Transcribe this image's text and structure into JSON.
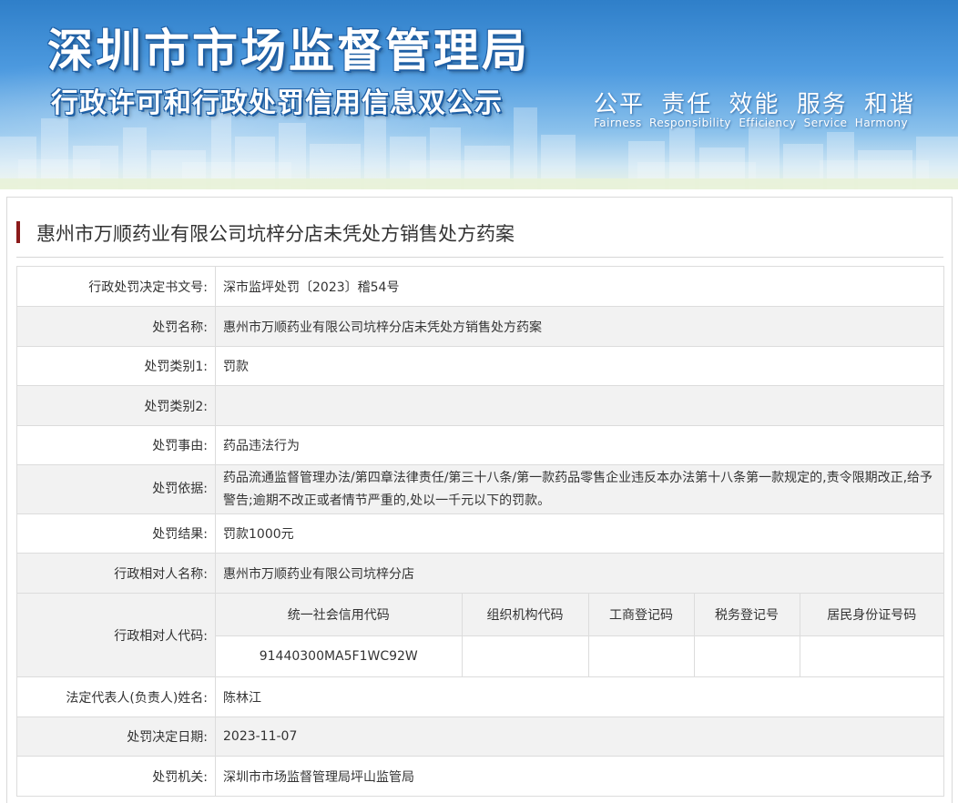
{
  "banner": {
    "title": "深圳市市场监督管理局",
    "subtitle": "行政许可和行政处罚信用信息双公示",
    "values_cn": "公平 责任 效能 服务 和谐",
    "values_en": "Fairness Responsibility Efficiency Service Harmony"
  },
  "page": {
    "title": "惠州市万顺药业有限公司坑梓分店未凭处方销售处方药案"
  },
  "details": {
    "rows": [
      {
        "label": "行政处罚决定书文号:",
        "value": "深市监坪处罚〔2023〕稽54号"
      },
      {
        "label": "处罚名称:",
        "value": "惠州市万顺药业有限公司坑梓分店未凭处方销售处方药案"
      },
      {
        "label": "处罚类别1:",
        "value": "罚款"
      },
      {
        "label": "处罚类别2:",
        "value": ""
      },
      {
        "label": "处罚事由:",
        "value": "药品违法行为"
      },
      {
        "label": "处罚依据:",
        "value": "药品流通监督管理办法/第四章法律责任/第三十八条/第一款药品零售企业违反本办法第十八条第一款规定的,责令限期改正,给予警告;逾期不改正或者情节严重的,处以一千元以下的罚款。"
      },
      {
        "label": "处罚结果:",
        "value": "罚款1000元"
      },
      {
        "label": "行政相对人名称:",
        "value": "惠州市万顺药业有限公司坑梓分店"
      }
    ],
    "codes": {
      "label": "行政相对人代码:",
      "headers": [
        "统一社会信用代码",
        "组织机构代码",
        "工商登记码",
        "税务登记号",
        "居民身份证号码"
      ],
      "values": [
        "91440300MA5F1WC92W",
        "",
        "",
        "",
        ""
      ]
    },
    "rows_after": [
      {
        "label": "法定代表人(负责人)姓名:",
        "value": "陈林江"
      },
      {
        "label": "处罚决定日期:",
        "value": "2023-11-07"
      },
      {
        "label": "处罚机关:",
        "value": "深圳市市场监督管理局坪山监管局"
      }
    ]
  }
}
